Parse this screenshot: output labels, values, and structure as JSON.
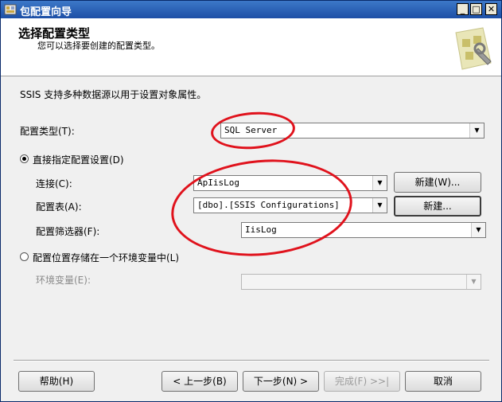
{
  "window": {
    "title": "包配置向导"
  },
  "header": {
    "title": "选择配置类型",
    "subtitle": "您可以选择要创建的配置类型。"
  },
  "content": {
    "intro": "SSIS 支持多种数据源以用于设置对象属性。",
    "config_type_label": "配置类型(T):",
    "config_type_value": "SQL Server",
    "direct_option_label": "直接指定配置设置(D)",
    "connection_label": "连接(C):",
    "connection_value": "ApIisLog",
    "new_connection_label": "新建(W)...",
    "config_table_label": "配置表(A):",
    "config_table_value": "[dbo].[SSIS Configurations]",
    "new_table_label": "新建...",
    "config_filter_label": "配置筛选器(F):",
    "config_filter_value": "IisLog",
    "env_option_label": "配置位置存储在一个环境变量中(L)",
    "env_var_label": "环境变量(E):",
    "env_var_value": ""
  },
  "footer": {
    "help": "帮助(H)",
    "back": "< 上一步(B)",
    "next": "下一步(N) >",
    "finish": "完成(F) >>|",
    "cancel": "取消"
  },
  "colors": {
    "annotation": "#e0121c",
    "titlebar": "#1d4fa6"
  }
}
